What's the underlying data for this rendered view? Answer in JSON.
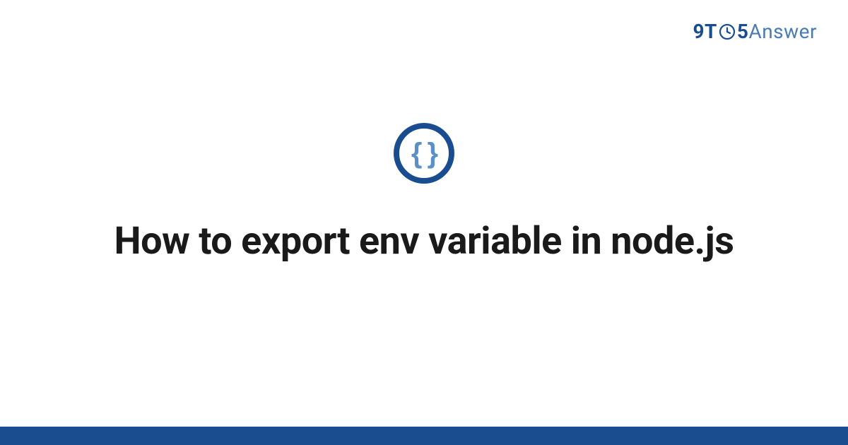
{
  "logo": {
    "part1": "9T",
    "part2": "5",
    "part3": "Answer"
  },
  "category_icon": {
    "symbol": "{ }",
    "name": "code-braces"
  },
  "title": "How to export env variable in node.js",
  "colors": {
    "brand_dark": "#1a4d8f",
    "brand_light": "#4a7bb5",
    "icon_fill": "#5a90c8",
    "text": "#1a1a1a"
  }
}
